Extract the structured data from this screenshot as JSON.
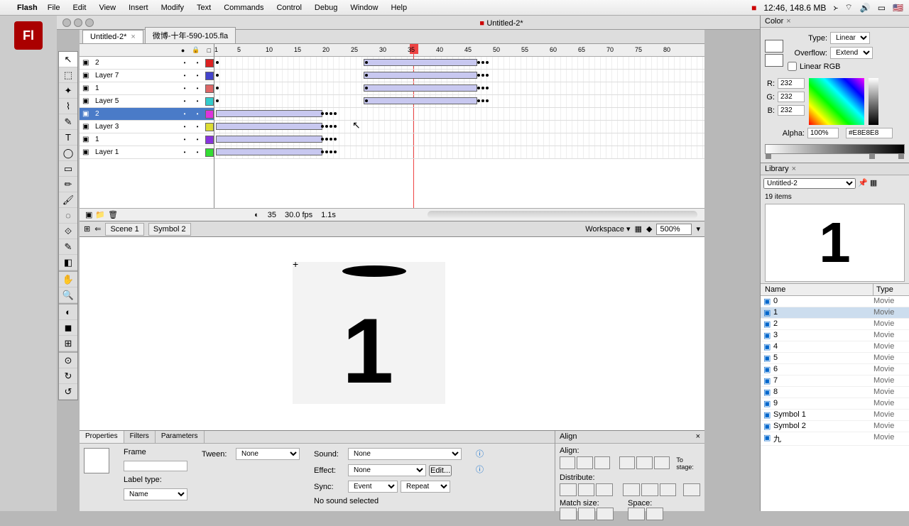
{
  "menubar": {
    "app": "Flash",
    "items": [
      "File",
      "Edit",
      "View",
      "Insert",
      "Modify",
      "Text",
      "Commands",
      "Control",
      "Debug",
      "Window",
      "Help"
    ],
    "clock": "12:46, 148.6 MB"
  },
  "window": {
    "title": "Untitled-2*"
  },
  "doctabs": [
    {
      "label": "Untitled-2*",
      "active": true
    },
    {
      "label": "微博-十年-590-105.fla",
      "active": false
    }
  ],
  "timeline": {
    "head_markers": [
      "1",
      "5",
      "10",
      "15",
      "20",
      "25",
      "30",
      "35",
      "40",
      "45",
      "50",
      "55",
      "60",
      "65",
      "70",
      "75",
      "80"
    ],
    "layers": [
      {
        "name": "2",
        "color": "#d22",
        "selected": false
      },
      {
        "name": "Layer 7",
        "color": "#44c",
        "selected": false
      },
      {
        "name": "1",
        "color": "#d66",
        "selected": false
      },
      {
        "name": "Layer 5",
        "color": "#3cc",
        "selected": false
      },
      {
        "name": "2",
        "color": "#d3d",
        "selected": true
      },
      {
        "name": "Layer 3",
        "color": "#dd3",
        "selected": false
      },
      {
        "name": "1",
        "color": "#83d",
        "selected": false
      },
      {
        "name": "Layer 1",
        "color": "#3d3",
        "selected": false
      }
    ],
    "status": {
      "frame": "35",
      "fps": "30.0 fps",
      "time": "1.1s"
    }
  },
  "editbar": {
    "scene": "Scene 1",
    "symbol": "Symbol 2",
    "workspace": "Workspace ▾",
    "zoom": "500%"
  },
  "stage": {
    "glyph": "1"
  },
  "properties": {
    "tabs": [
      "Properties",
      "Filters",
      "Parameters"
    ],
    "frame_label": "Frame",
    "tween_label": "Tween:",
    "tween_value": "None",
    "labeltype_label": "Label type:",
    "labeltype_value": "Name",
    "sound_label": "Sound:",
    "sound_value": "None",
    "effect_label": "Effect:",
    "effect_value": "None",
    "edit_btn": "Edit...",
    "sync_label": "Sync:",
    "sync_value": "Event",
    "repeat_value": "Repeat",
    "nosound": "No sound selected"
  },
  "align": {
    "title": "Align",
    "align_label": "Align:",
    "distribute_label": "Distribute:",
    "matchsize_label": "Match size:",
    "space_label": "Space:",
    "tostage_label": "To stage:"
  },
  "color": {
    "title": "Color",
    "type_label": "Type:",
    "type_value": "Linear",
    "overflow_label": "Overflow:",
    "overflow_value": "Extend",
    "linear_rgb": "Linear RGB",
    "r": "232",
    "g": "232",
    "b": "232",
    "alpha_label": "Alpha:",
    "alpha": "100%",
    "hex": "#E8E8E8"
  },
  "library": {
    "title": "Library",
    "source": "Untitled-2",
    "count": "19 items",
    "col_name": "Name",
    "col_type": "Type",
    "preview_glyph": "1",
    "items": [
      {
        "name": "0",
        "type": "Movie",
        "selected": false
      },
      {
        "name": "1",
        "type": "Movie",
        "selected": true
      },
      {
        "name": "2",
        "type": "Movie",
        "selected": false
      },
      {
        "name": "3",
        "type": "Movie",
        "selected": false
      },
      {
        "name": "4",
        "type": "Movie",
        "selected": false
      },
      {
        "name": "5",
        "type": "Movie",
        "selected": false
      },
      {
        "name": "6",
        "type": "Movie",
        "selected": false
      },
      {
        "name": "7",
        "type": "Movie",
        "selected": false
      },
      {
        "name": "8",
        "type": "Movie",
        "selected": false
      },
      {
        "name": "9",
        "type": "Movie",
        "selected": false
      },
      {
        "name": "Symbol 1",
        "type": "Movie",
        "selected": false
      },
      {
        "name": "Symbol 2",
        "type": "Movie",
        "selected": false
      },
      {
        "name": "九",
        "type": "Movie",
        "selected": false
      }
    ]
  },
  "tools": [
    "↖",
    "⬚",
    "✦",
    "⌇",
    "✎",
    "T",
    "◯",
    "▭",
    "✏",
    "✎",
    "◌",
    "⟐",
    "✋",
    "🔍",
    " ",
    "⊞",
    "⊡",
    " ",
    "⊙",
    "↻",
    "↺"
  ]
}
